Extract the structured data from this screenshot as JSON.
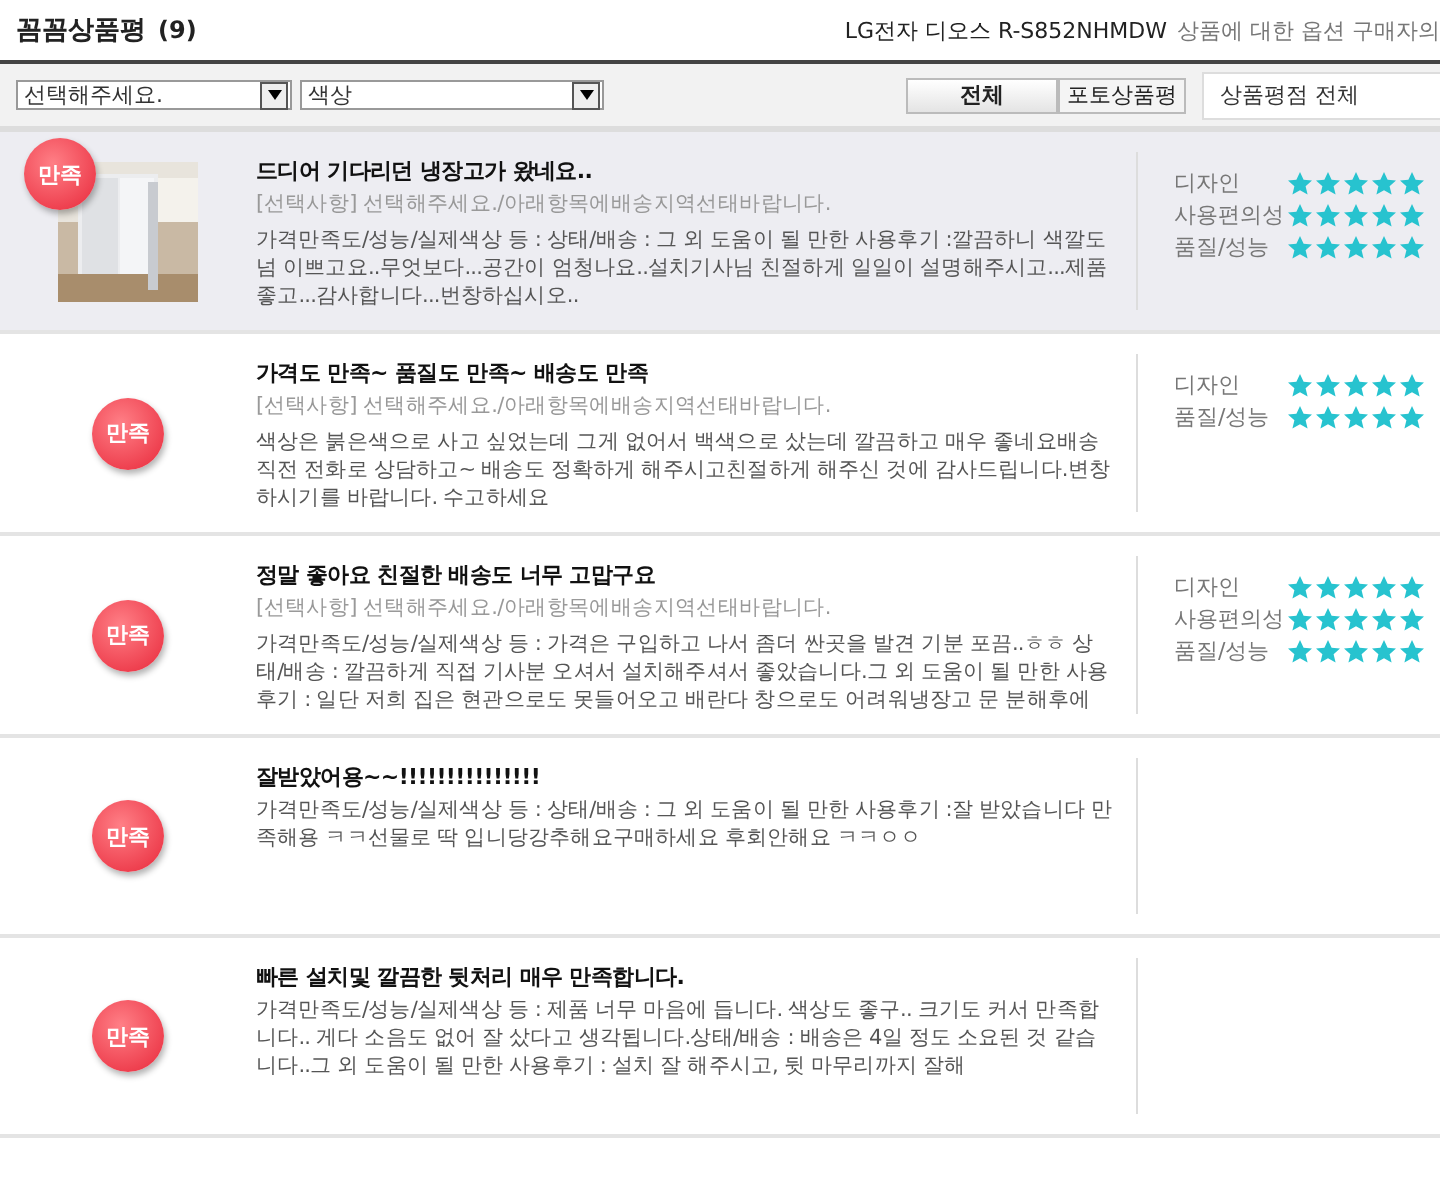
{
  "header": {
    "title": "꼼꼼상품평",
    "count": "(9)",
    "product": "LG전자 디오스 R-S852NHMDW",
    "note": "상품에 대한 옵션 구매자의"
  },
  "filters": {
    "option_select": "선택해주세요.",
    "color_select": "색상",
    "tabs": [
      {
        "label": "전체",
        "selected": true
      },
      {
        "label": "포토상품평",
        "selected": false
      }
    ],
    "rating_select": "상품평점 전체"
  },
  "reviews": [
    {
      "badge": "만족",
      "photo": true,
      "highlighted": true,
      "title": "드디어 기다리던 냉장고가 왔네요..",
      "option": "[선택사항] 선택해주세요./아래항목에배송지역선태바랍니다.",
      "body": "가격만족도/성능/실제색상 등 : 상태/배송 : 그 외 도움이 될 만한 사용후기 :깔끔하니 색깔도 넘 이쁘고요..무엇보다...공간이 엄청나요..설치기사님 친절하게 일일이 설명해주시고...제품좋고...감사합니다...번창하십시오..",
      "ratings": [
        {
          "label": "디자인",
          "stars": 5
        },
        {
          "label": "사용편의성",
          "stars": 5
        },
        {
          "label": "품질/성능",
          "stars": 5
        }
      ]
    },
    {
      "badge": "만족",
      "photo": false,
      "highlighted": false,
      "title": "가격도 만족~ 품질도 만족~ 배송도 만족",
      "option": "[선택사항] 선택해주세요./아래항목에배송지역선태바랍니다.",
      "body": "색상은 붉은색으로 사고 싶었는데 그게 없어서 백색으로 샀는데 깔끔하고 매우 좋네요배송 직전 전화로 상담하고~ 배송도 정확하게 해주시고친절하게 해주신 것에 감사드립니다.변창하시기를 바랍니다. 수고하세요",
      "ratings": [
        {
          "label": "디자인",
          "stars": 5
        },
        {
          "label": "품질/성능",
          "stars": 5
        }
      ]
    },
    {
      "badge": "만족",
      "photo": false,
      "highlighted": false,
      "title": "정말 좋아요 친절한 배송도 너무 고맙구요",
      "option": "[선택사항] 선택해주세요./아래항목에배송지역선태바랍니다.",
      "body": "가격만족도/성능/실제색상 등 : 가격은 구입하고 나서 좀더 싼곳을 발견 기분 포끔..ㅎㅎ 상태/배송 : 깔끔하게 직접 기사분 오셔서 설치해주셔서 좋았습니다.그 외 도움이 될 만한 사용후기 : 일단 저희 집은 현관으로도 못들어오고 배란다 창으로도 어려워냉장고 문 분해후에",
      "ratings": [
        {
          "label": "디자인",
          "stars": 5
        },
        {
          "label": "사용편의성",
          "stars": 5
        },
        {
          "label": "품질/성능",
          "stars": 5
        }
      ]
    },
    {
      "badge": "만족",
      "photo": false,
      "highlighted": false,
      "title": "잘받았어용~~!!!!!!!!!!!!!!!",
      "body": "가격만족도/성능/실제색상 등 : 상태/배송 : 그 외 도움이 될 만한 사용후기 :잘 받았습니다 만족해용 ㅋㅋ선물로 딱 입니당강추해요구매하세요 후회안해요 ㅋㅋㅇㅇ"
    },
    {
      "badge": "만족",
      "photo": false,
      "highlighted": false,
      "title": "빠른 설치및 깔끔한 뒷처리 매우 만족합니다.",
      "body": "가격만족도/성능/실제색상 등 : 제품 너무 마음에 듭니다. 색상도 좋구.. 크기도 커서 만족합니다.. 게다 소음도 없어 잘 샀다고 생각됩니다.상태/배송 : 배송은 4일 정도 소요된 것 같습니다..그 외 도움이 될 만한 사용후기 : 설치 잘 해주시고, 뒷 마무리까지 잘해"
    }
  ]
}
